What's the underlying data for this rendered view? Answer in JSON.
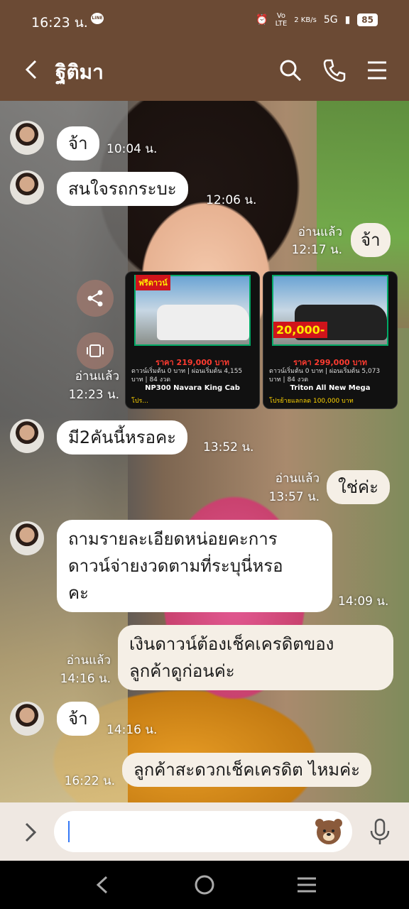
{
  "status": {
    "time": "16:23 น.",
    "line_badge": "LINE",
    "net_speed": "2 KB/s",
    "network": "5G",
    "battery": "85"
  },
  "header": {
    "title": "ฐิติมา"
  },
  "messages": [
    {
      "text": "จ้า",
      "time": "10:04 น."
    },
    {
      "text": "สนใจรถกระบะ",
      "time": "12:06 น."
    },
    {
      "text": "จ้า",
      "read": "อ่านแล้ว",
      "time": "12:17 น."
    },
    {
      "read": "อ่านแล้ว",
      "time": "12:23 น."
    },
    {
      "text": "มี2คันนี้หรอคะ",
      "time": "13:52 น."
    },
    {
      "text": "ใช่ค่ะ",
      "read": "อ่านแล้ว",
      "time": "13:57 น."
    },
    {
      "text": "ถามรายละเอียดหน่อยคะการดาวน์จ่ายงวดตามที่ระบุนี่หรอคะ",
      "line1": "ถามรายละเอียดหน่อยคะการ",
      "line2": "ดาวน์จ่ายงวดตามที่ระบุนี่หรอ",
      "line3": "คะ",
      "time": "14:09 น."
    },
    {
      "line1": "เงินดาวน์ต้องเช็คเครดิตของ",
      "line2": "ลูกค้าดูก่อนค่ะ",
      "read": "อ่านแล้ว",
      "time": "14:16 น."
    },
    {
      "text": "จ้า",
      "time": "14:16 น."
    },
    {
      "text": "ลูกค้าสะดวกเช็คเครดิต ไหมค่ะ",
      "time": "16:22 น."
    }
  ],
  "cards": [
    {
      "badge": "ฟรีดาวน์",
      "price": "ราคา 219,000 บาท",
      "terms": "ดาวน์เริ่มต้น 0 บาท | ผ่อนเริ่มต้น 4,155 บาท | 84 งวด",
      "model": "NP300 Navara King Cab",
      "promo": "โปร..."
    },
    {
      "badge": "20,000-",
      "price": "ราคา 299,000 บาท",
      "terms": "ดาวน์เริ่มต้น 0 บาท | ผ่อนเริ่มต้น 5,073 บาท | 84 งวด",
      "model": "Triton All New Mega",
      "promo": "โปรย้ายแลกลด 100,000 บาท"
    }
  ],
  "icons": {
    "back": "chevron-left-icon",
    "search": "search-icon",
    "call": "phone-icon",
    "menu": "menu-icon",
    "share": "share-icon",
    "save": "gallery-icon",
    "expand": "chevron-right-icon",
    "sticker": "sticker-icon",
    "mic": "microphone-icon"
  }
}
